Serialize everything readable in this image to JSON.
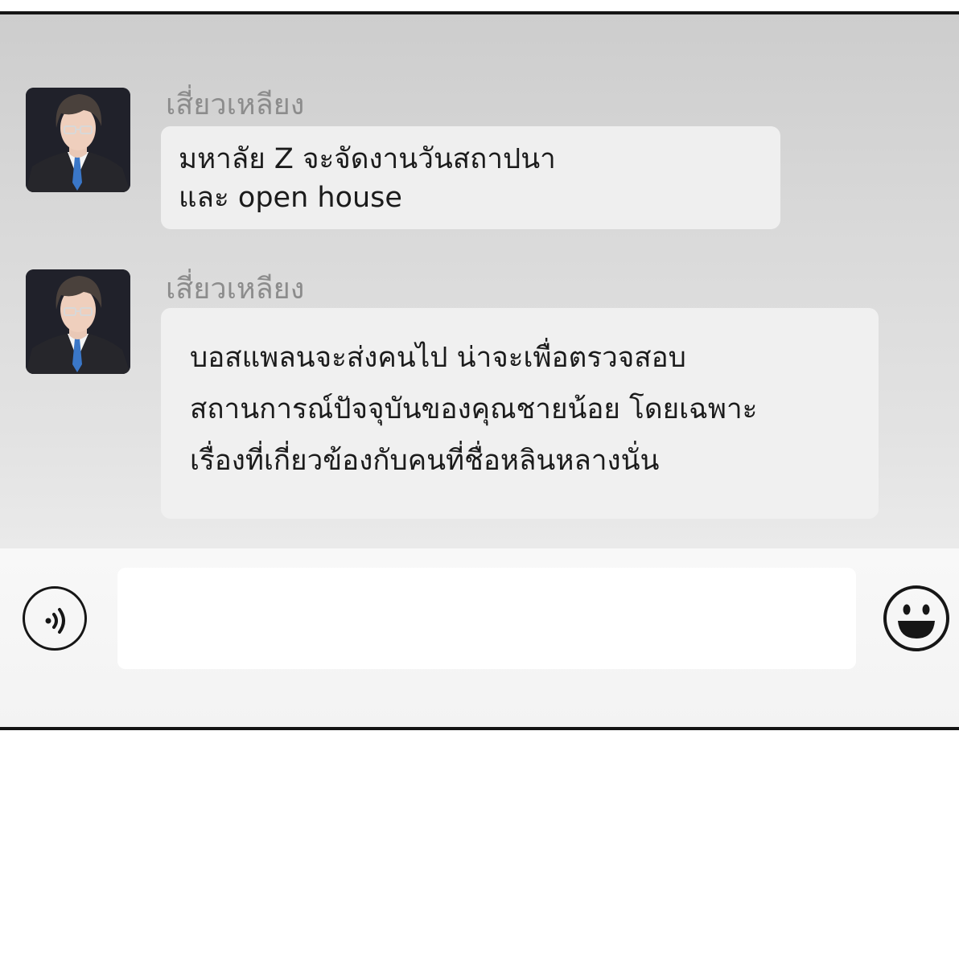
{
  "chat": {
    "messages": [
      {
        "sender": "เสี่ยวเหลียง",
        "lines": [
          "มหาลัย Z จะจัดงานวันสถาปนา",
          "และ open house"
        ]
      },
      {
        "sender": "เสี่ยวเหลียง",
        "lines": [
          "บอสแพลนจะส่งคนไป น่าจะเพื่อตรวจสอบ",
          "สถานการณ์ปัจจุบันของคุณชายน้อย โดยเฉพาะ",
          "เรื่องที่เกี่ยวข้องกับคนที่ชื่อหลินหลางนั่น"
        ]
      }
    ]
  },
  "input_bar": {
    "voice_icon": "voice-icon",
    "message_value": "",
    "emoji_icon": "emoji-icon"
  }
}
